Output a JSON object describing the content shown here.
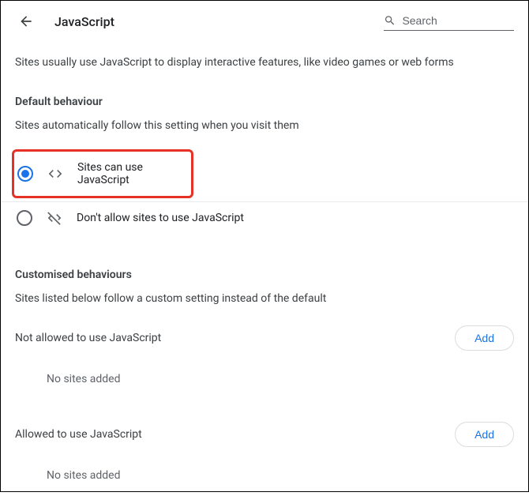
{
  "header": {
    "title": "JavaScript",
    "search_placeholder": "Search"
  },
  "description": "Sites usually use JavaScript to display interactive features, like video games or web forms",
  "default_section": {
    "heading": "Default behaviour",
    "sub": "Sites automatically follow this setting when you visit them",
    "options": [
      {
        "label": "Sites can use JavaScript"
      },
      {
        "label": "Don't allow sites to use JavaScript"
      }
    ]
  },
  "custom_section": {
    "heading": "Customised behaviours",
    "sub": "Sites listed below follow a custom setting instead of the default",
    "lists": [
      {
        "title": "Not allowed to use JavaScript",
        "add_label": "Add",
        "empty": "No sites added"
      },
      {
        "title": "Allowed to use JavaScript",
        "add_label": "Add",
        "empty": "No sites added"
      }
    ]
  }
}
